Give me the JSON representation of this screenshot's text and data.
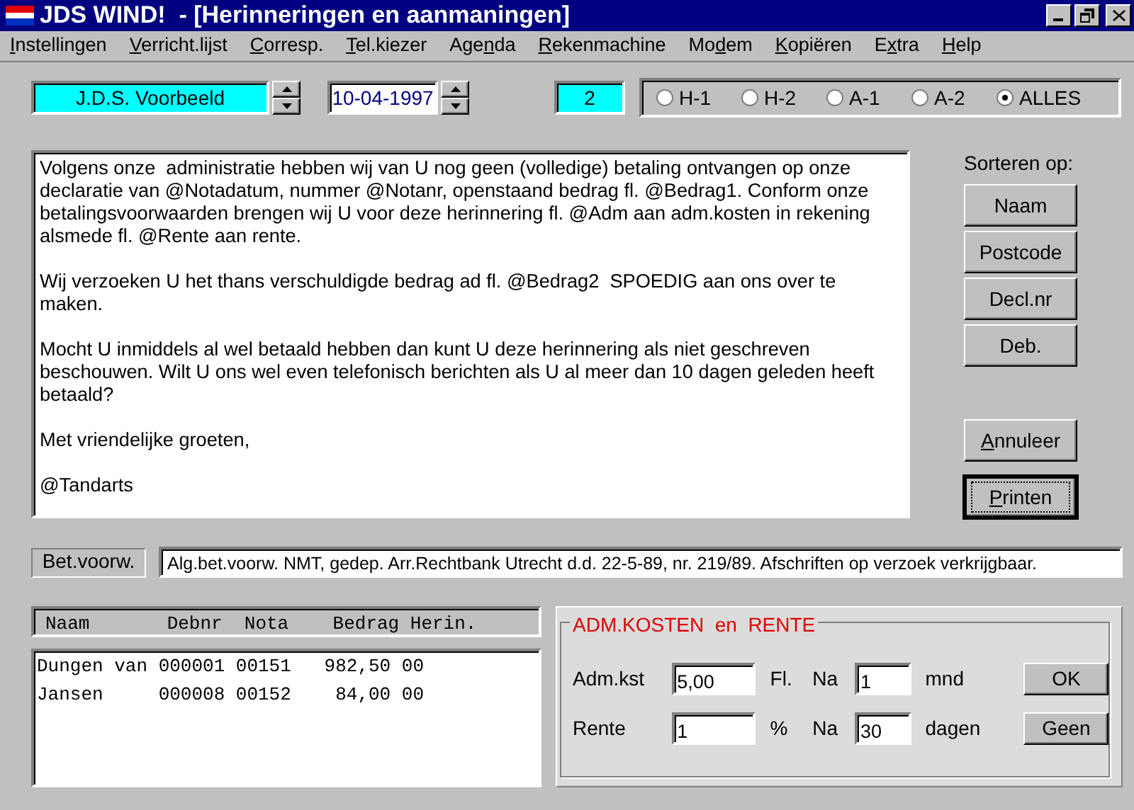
{
  "window": {
    "title": "JDS WIND!  - [Herinneringen en aanmaningen]"
  },
  "menu": [
    {
      "key": "I",
      "after": "nstellingen"
    },
    {
      "key": "V",
      "after": "erricht.lijst"
    },
    {
      "key": "C",
      "after": "orresp."
    },
    {
      "key": "T",
      "after": "el.kiezer"
    },
    {
      "before": "Age",
      "key": "n",
      "after": "da"
    },
    {
      "key": "R",
      "after": "ekenmachine"
    },
    {
      "before": "Mo",
      "key": "d",
      "after": "em"
    },
    {
      "key": "K",
      "after": "opiëren"
    },
    {
      "before": "E",
      "key": "x",
      "after": "tra"
    },
    {
      "key": "H",
      "after": "elp"
    }
  ],
  "patient": {
    "value": "J.D.S. Voorbeeld"
  },
  "date": {
    "value": "10-04-1997"
  },
  "count": {
    "value": "2"
  },
  "filters": [
    {
      "label": "H-1",
      "selected": false
    },
    {
      "label": "H-2",
      "selected": false
    },
    {
      "label": "A-1",
      "selected": false
    },
    {
      "label": "A-2",
      "selected": false
    },
    {
      "label": "ALLES",
      "selected": true
    }
  ],
  "letter": {
    "paragraphs": [
      "Volgens onze  administratie hebben wij van U nog geen (volledige) betaling ontvangen op onze declaratie van @Notadatum, nummer @Notanr, openstaand bedrag fl. @Bedrag1. Conform onze betalingsvoorwaarden brengen wij U voor deze herinnering fl. @Adm aan adm.kosten in rekening alsmede fl. @Rente aan rente.",
      "Wij verzoeken U het thans verschuldigde bedrag ad fl. @Bedrag2  SPOEDIG aan ons over te maken.",
      "Mocht U inmiddels al wel betaald hebben dan kunt U deze herinnering als niet geschreven beschouwen. Wilt U ons wel even telefonisch berichten als U al meer dan 10 dagen geleden heeft betaald?",
      "Met vriendelijke groeten,",
      "@Tandarts"
    ]
  },
  "sort": {
    "label": "Sorteren op:",
    "buttons": [
      "Naam",
      "Postcode",
      "Decl.nr",
      "Deb."
    ]
  },
  "actions": [
    {
      "key": "A",
      "after": "nnuleer",
      "default": false
    },
    {
      "key": "P",
      "after": "rinten",
      "default": true
    }
  ],
  "conditions": {
    "label": "Bet.voorw.",
    "value": "Alg.bet.voorw. NMT, gedep. Arr.Rechtbank Utrecht d.d. 22-5-89, nr. 219/89. Afschriften op verzoek verkrijgbaar."
  },
  "list": {
    "columns": [
      "Naam",
      "Debnr",
      "Nota",
      "Bedrag",
      "Herin."
    ],
    "rows": [
      [
        "Dungen van",
        "000001",
        "00151",
        "982,50",
        "00"
      ],
      [
        "Jansen",
        "000008",
        "00152",
        "84,00",
        "00"
      ]
    ]
  },
  "fees": {
    "legend": "ADM.KOSTEN  en  RENTE",
    "rows": [
      {
        "label": "Adm.kst",
        "value": "5,00",
        "unit": "Fl.",
        "after": "Na",
        "after_value": "1",
        "period": "mnd",
        "button": "OK"
      },
      {
        "label": "Rente",
        "value": "1",
        "unit": "%",
        "after": "Na",
        "after_value": "30",
        "period": "dagen",
        "button": "Geen"
      }
    ]
  }
}
